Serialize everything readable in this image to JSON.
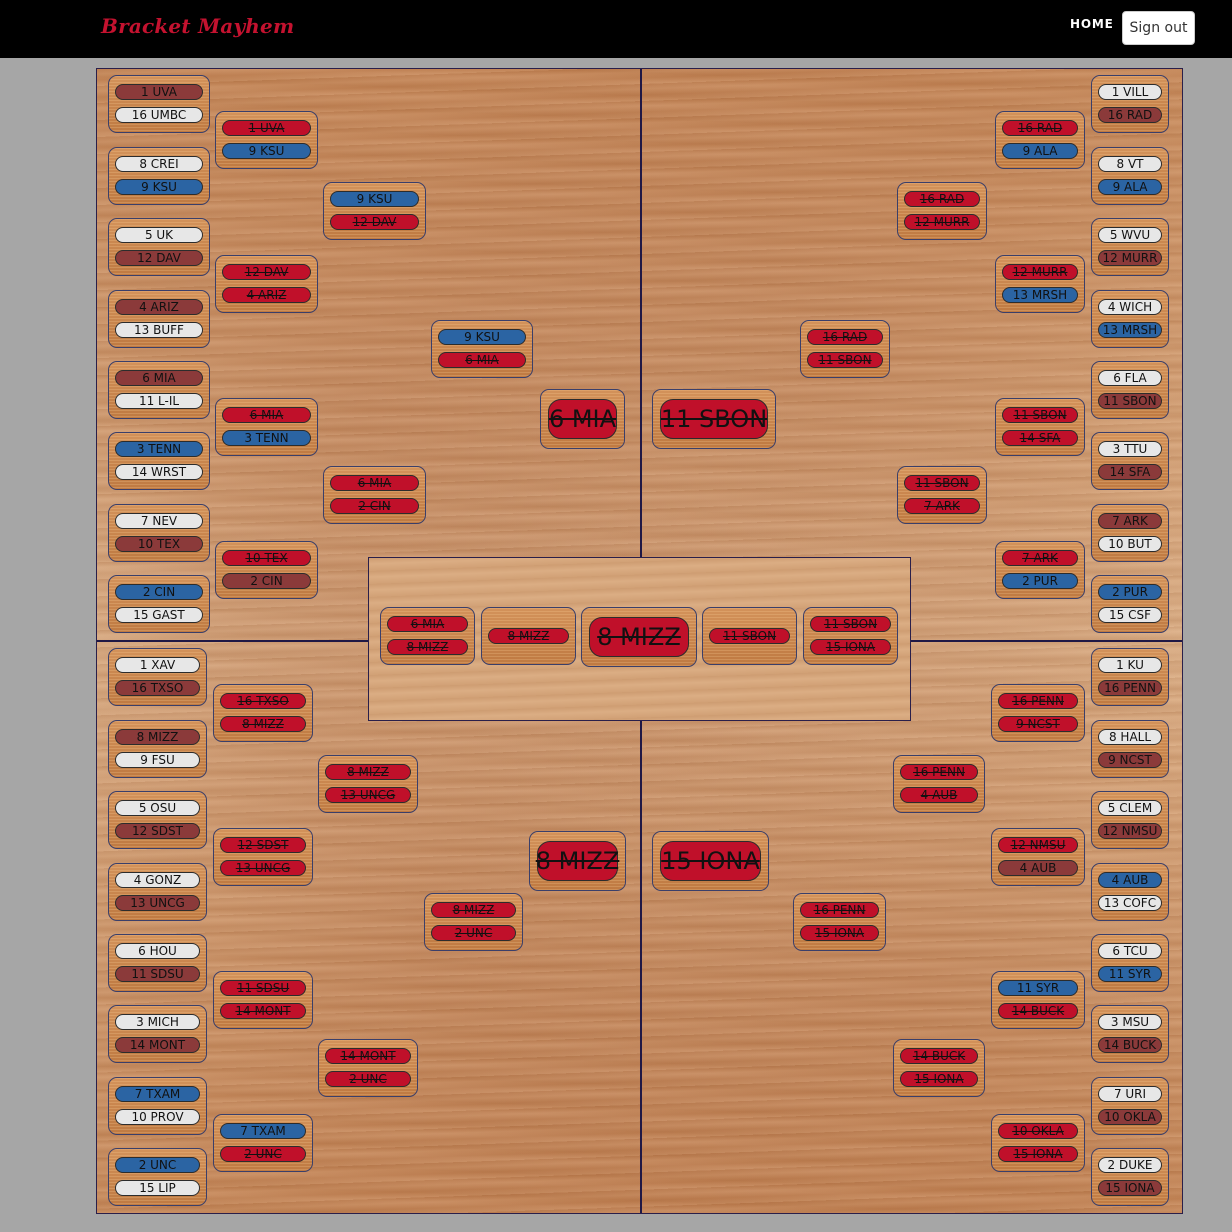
{
  "header": {
    "brand": "Bracket Mayhem",
    "home": "HOME",
    "signout": "Sign out"
  },
  "colors": {
    "topbar": "#000000",
    "brand": "#c4122f",
    "page_bg": "#a6a6a6",
    "pick_white": "#e7e7e7",
    "pick_maroon": "#8b3a3a",
    "pick_blue": "#2b64a3",
    "pick_red": "#c0102a"
  },
  "legend_note": "",
  "bracket": {
    "top_left": {
      "round1": [
        {
          "teams": [
            {
              "label": "1 UVA",
              "style": "maroon"
            },
            {
              "label": "16 UMBC",
              "style": "white"
            }
          ]
        },
        {
          "teams": [
            {
              "label": "8 CREI",
              "style": "white"
            },
            {
              "label": "9 KSU",
              "style": "blue"
            }
          ]
        },
        {
          "teams": [
            {
              "label": "5 UK",
              "style": "white"
            },
            {
              "label": "12 DAV",
              "style": "maroon"
            }
          ]
        },
        {
          "teams": [
            {
              "label": "4 ARIZ",
              "style": "maroon"
            },
            {
              "label": "13 BUFF",
              "style": "white"
            }
          ]
        },
        {
          "teams": [
            {
              "label": "6 MIA",
              "style": "maroon"
            },
            {
              "label": "11 L-IL",
              "style": "white"
            }
          ]
        },
        {
          "teams": [
            {
              "label": "3 TENN",
              "style": "blue"
            },
            {
              "label": "14 WRST",
              "style": "white"
            }
          ]
        },
        {
          "teams": [
            {
              "label": "7 NEV",
              "style": "white"
            },
            {
              "label": "10 TEX",
              "style": "maroon"
            }
          ]
        },
        {
          "teams": [
            {
              "label": "2 CIN",
              "style": "blue"
            },
            {
              "label": "15 GAST",
              "style": "white"
            }
          ]
        }
      ],
      "round2": [
        {
          "teams": [
            {
              "label": "1 UVA",
              "style": "red-strike"
            },
            {
              "label": "9 KSU",
              "style": "blue"
            }
          ]
        },
        {
          "teams": [
            {
              "label": "12 DAV",
              "style": "red-strike"
            },
            {
              "label": "4 ARIZ",
              "style": "red-strike"
            }
          ]
        },
        {
          "teams": [
            {
              "label": "6 MIA",
              "style": "red-strike"
            },
            {
              "label": "3 TENN",
              "style": "blue"
            }
          ]
        },
        {
          "teams": [
            {
              "label": "10 TEX",
              "style": "red-strike"
            },
            {
              "label": "2 CIN",
              "style": "maroon"
            }
          ]
        }
      ],
      "round3": [
        {
          "teams": [
            {
              "label": "9 KSU",
              "style": "blue"
            },
            {
              "label": "12 DAV",
              "style": "red-strike"
            }
          ]
        },
        {
          "teams": [
            {
              "label": "6 MIA",
              "style": "red-strike"
            },
            {
              "label": "2 CIN",
              "style": "red-strike"
            }
          ]
        }
      ],
      "round4": [
        {
          "teams": [
            {
              "label": "9 KSU",
              "style": "blue"
            },
            {
              "label": "6 MIA",
              "style": "red-strike"
            }
          ]
        }
      ],
      "winner": {
        "label": "6 MIA",
        "style": "red-strike"
      }
    },
    "top_right": {
      "round1": [
        {
          "teams": [
            {
              "label": "1 VILL",
              "style": "white"
            },
            {
              "label": "16 RAD",
              "style": "maroon"
            }
          ]
        },
        {
          "teams": [
            {
              "label": "8 VT",
              "style": "white"
            },
            {
              "label": "9 ALA",
              "style": "blue"
            }
          ]
        },
        {
          "teams": [
            {
              "label": "5 WVU",
              "style": "white"
            },
            {
              "label": "12 MURR",
              "style": "maroon"
            }
          ]
        },
        {
          "teams": [
            {
              "label": "4 WICH",
              "style": "white"
            },
            {
              "label": "13 MRSH",
              "style": "blue"
            }
          ]
        },
        {
          "teams": [
            {
              "label": "6 FLA",
              "style": "white"
            },
            {
              "label": "11 SBON",
              "style": "maroon"
            }
          ]
        },
        {
          "teams": [
            {
              "label": "3 TTU",
              "style": "white"
            },
            {
              "label": "14 SFA",
              "style": "maroon"
            }
          ]
        },
        {
          "teams": [
            {
              "label": "7 ARK",
              "style": "maroon"
            },
            {
              "label": "10 BUT",
              "style": "white"
            }
          ]
        },
        {
          "teams": [
            {
              "label": "2 PUR",
              "style": "blue"
            },
            {
              "label": "15 CSF",
              "style": "white"
            }
          ]
        }
      ],
      "round2": [
        {
          "teams": [
            {
              "label": "16 RAD",
              "style": "red-strike"
            },
            {
              "label": "9 ALA",
              "style": "blue"
            }
          ]
        },
        {
          "teams": [
            {
              "label": "12 MURR",
              "style": "red-strike"
            },
            {
              "label": "13 MRSH",
              "style": "blue"
            }
          ]
        },
        {
          "teams": [
            {
              "label": "11 SBON",
              "style": "red-strike"
            },
            {
              "label": "14 SFA",
              "style": "red-strike"
            }
          ]
        },
        {
          "teams": [
            {
              "label": "7 ARK",
              "style": "red-strike"
            },
            {
              "label": "2 PUR",
              "style": "blue"
            }
          ]
        }
      ],
      "round3": [
        {
          "teams": [
            {
              "label": "16 RAD",
              "style": "red-strike"
            },
            {
              "label": "12 MURR",
              "style": "red-strike"
            }
          ]
        },
        {
          "teams": [
            {
              "label": "11 SBON",
              "style": "red-strike"
            },
            {
              "label": "7 ARK",
              "style": "red-strike"
            }
          ]
        }
      ],
      "round4": [
        {
          "teams": [
            {
              "label": "16 RAD",
              "style": "red-strike"
            },
            {
              "label": "11 SBON",
              "style": "red-strike"
            }
          ]
        }
      ],
      "winner": {
        "label": "11 SBON",
        "style": "red-strike"
      }
    },
    "bottom_left": {
      "round1": [
        {
          "teams": [
            {
              "label": "1 XAV",
              "style": "white"
            },
            {
              "label": "16 TXSO",
              "style": "maroon"
            }
          ]
        },
        {
          "teams": [
            {
              "label": "8 MIZZ",
              "style": "maroon"
            },
            {
              "label": "9 FSU",
              "style": "white"
            }
          ]
        },
        {
          "teams": [
            {
              "label": "5 OSU",
              "style": "white"
            },
            {
              "label": "12 SDST",
              "style": "maroon"
            }
          ]
        },
        {
          "teams": [
            {
              "label": "4 GONZ",
              "style": "white"
            },
            {
              "label": "13 UNCG",
              "style": "maroon"
            }
          ]
        },
        {
          "teams": [
            {
              "label": "6 HOU",
              "style": "white"
            },
            {
              "label": "11 SDSU",
              "style": "maroon"
            }
          ]
        },
        {
          "teams": [
            {
              "label": "3 MICH",
              "style": "white"
            },
            {
              "label": "14 MONT",
              "style": "maroon"
            }
          ]
        },
        {
          "teams": [
            {
              "label": "7 TXAM",
              "style": "blue"
            },
            {
              "label": "10 PROV",
              "style": "white"
            }
          ]
        },
        {
          "teams": [
            {
              "label": "2 UNC",
              "style": "blue"
            },
            {
              "label": "15 LIP",
              "style": "white"
            }
          ]
        }
      ],
      "round2": [
        {
          "teams": [
            {
              "label": "16 TXSO",
              "style": "red-strike"
            },
            {
              "label": "8 MIZZ",
              "style": "red-strike"
            }
          ]
        },
        {
          "teams": [
            {
              "label": "12 SDST",
              "style": "red-strike"
            },
            {
              "label": "13 UNCG",
              "style": "red-strike"
            }
          ]
        },
        {
          "teams": [
            {
              "label": "11 SDSU",
              "style": "red-strike"
            },
            {
              "label": "14 MONT",
              "style": "red-strike"
            }
          ]
        },
        {
          "teams": [
            {
              "label": "7 TXAM",
              "style": "blue"
            },
            {
              "label": "2 UNC",
              "style": "red-strike"
            }
          ]
        }
      ],
      "round3": [
        {
          "teams": [
            {
              "label": "8 MIZZ",
              "style": "red-strike"
            },
            {
              "label": "13 UNCG",
              "style": "red-strike"
            }
          ]
        },
        {
          "teams": [
            {
              "label": "14 MONT",
              "style": "red-strike"
            },
            {
              "label": "2 UNC",
              "style": "red-strike"
            }
          ]
        }
      ],
      "round4": [
        {
          "teams": [
            {
              "label": "8 MIZZ",
              "style": "red-strike"
            },
            {
              "label": "2 UNC",
              "style": "red-strike"
            }
          ]
        }
      ],
      "winner": {
        "label": "8 MIZZ",
        "style": "red-strike"
      }
    },
    "bottom_right": {
      "round1": [
        {
          "teams": [
            {
              "label": "1 KU",
              "style": "white"
            },
            {
              "label": "16 PENN",
              "style": "maroon"
            }
          ]
        },
        {
          "teams": [
            {
              "label": "8 HALL",
              "style": "white"
            },
            {
              "label": "9 NCST",
              "style": "maroon"
            }
          ]
        },
        {
          "teams": [
            {
              "label": "5 CLEM",
              "style": "white"
            },
            {
              "label": "12 NMSU",
              "style": "maroon"
            }
          ]
        },
        {
          "teams": [
            {
              "label": "4 AUB",
              "style": "blue"
            },
            {
              "label": "13 COFC",
              "style": "white"
            }
          ]
        },
        {
          "teams": [
            {
              "label": "6 TCU",
              "style": "white"
            },
            {
              "label": "11 SYR",
              "style": "blue"
            }
          ]
        },
        {
          "teams": [
            {
              "label": "3 MSU",
              "style": "white"
            },
            {
              "label": "14 BUCK",
              "style": "maroon"
            }
          ]
        },
        {
          "teams": [
            {
              "label": "7 URI",
              "style": "white"
            },
            {
              "label": "10 OKLA",
              "style": "maroon"
            }
          ]
        },
        {
          "teams": [
            {
              "label": "2 DUKE",
              "style": "white"
            },
            {
              "label": "15 IONA",
              "style": "maroon"
            }
          ]
        }
      ],
      "round2": [
        {
          "teams": [
            {
              "label": "16 PENN",
              "style": "red-strike"
            },
            {
              "label": "9 NCST",
              "style": "red-strike"
            }
          ]
        },
        {
          "teams": [
            {
              "label": "12 NMSU",
              "style": "red-strike"
            },
            {
              "label": "4 AUB",
              "style": "maroon"
            }
          ]
        },
        {
          "teams": [
            {
              "label": "11 SYR",
              "style": "blue"
            },
            {
              "label": "14 BUCK",
              "style": "red-strike"
            }
          ]
        },
        {
          "teams": [
            {
              "label": "10 OKLA",
              "style": "red-strike"
            },
            {
              "label": "15 IONA",
              "style": "red-strike"
            }
          ]
        }
      ],
      "round3": [
        {
          "teams": [
            {
              "label": "16 PENN",
              "style": "red-strike"
            },
            {
              "label": "4 AUB",
              "style": "red-strike"
            }
          ]
        },
        {
          "teams": [
            {
              "label": "14 BUCK",
              "style": "red-strike"
            },
            {
              "label": "15 IONA",
              "style": "red-strike"
            }
          ]
        }
      ],
      "round4": [
        {
          "teams": [
            {
              "label": "16 PENN",
              "style": "red-strike"
            },
            {
              "label": "15 IONA",
              "style": "red-strike"
            }
          ]
        }
      ],
      "winner": {
        "label": "15 IONA",
        "style": "red-strike"
      }
    },
    "final_four": {
      "left_semifinal": {
        "teams": [
          {
            "label": "6 MIA",
            "style": "red-strike"
          },
          {
            "label": "8 MIZZ",
            "style": "red-strike"
          }
        ]
      },
      "left_finalist": {
        "label": "8 MIZZ",
        "style": "red-strike"
      },
      "champion": {
        "label": "8 MIZZ",
        "style": "red-strike"
      },
      "right_finalist": {
        "label": "11 SBON",
        "style": "red-strike"
      },
      "right_semifinal": {
        "teams": [
          {
            "label": "11 SBON",
            "style": "red-strike"
          },
          {
            "label": "15 IONA",
            "style": "red-strike"
          }
        ]
      }
    }
  }
}
